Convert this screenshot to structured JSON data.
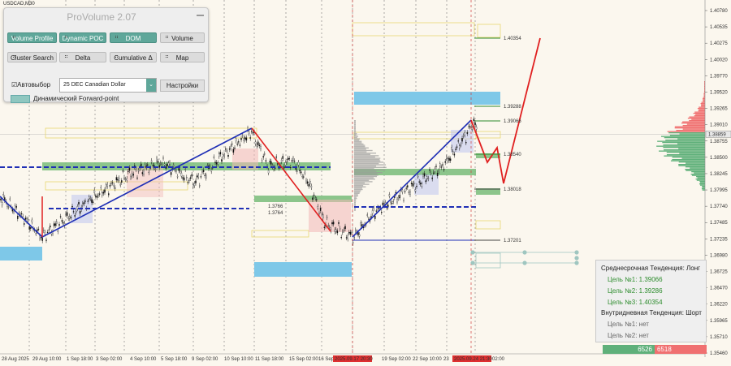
{
  "symbol": "USDCAD,M30",
  "panel": {
    "title": "ProVolume 2.07",
    "buttons": [
      {
        "label": "Volume Profile",
        "active": true
      },
      {
        "label": "Dynamic POC",
        "active": true
      },
      {
        "label": "DOM",
        "active": true
      },
      {
        "label": "Volume",
        "active": false
      },
      {
        "label": "Cluster Search",
        "active": false
      },
      {
        "label": "Delta",
        "active": false
      },
      {
        "label": "Cumulative Δ",
        "active": false
      },
      {
        "label": "Map",
        "active": false
      }
    ],
    "autoselect_label": "Автовыбор",
    "instrument": "25 DEC Canadian Dollar",
    "settings_label": "Настройки",
    "forward_label": "Динамический Forward-point"
  },
  "price_axis": [
    "1.40780",
    "1.40535",
    "1.40275",
    "1.40020",
    "1.39770",
    "1.39520",
    "1.39265",
    "1.39010",
    "1.38755",
    "1.38500",
    "1.38245",
    "1.37995",
    "1.37740",
    "1.37485",
    "1.37235",
    "1.36980",
    "1.36725",
    "1.36470",
    "1.36220",
    "1.35965",
    "1.35710",
    "1.35460"
  ],
  "current_price": "1.38859",
  "time_axis": [
    "28 Aug 2025",
    "29 Aug 10:00",
    "1 Sep 18:00",
    "3 Sep 02:00",
    "4 Sep 10:00",
    "5 Sep 18:00",
    "9 Sep 02:00",
    "10 Sep 10:00",
    "11 Sep 18:00",
    "15 Sep 02:00",
    "16 Sep",
    "19 Sep 02:00",
    "22 Sep 10:00",
    "23"
  ],
  "time_markers": [
    "2025.09.17 20:30",
    "2025.09.24 21:30"
  ],
  "time_tail": "02:00",
  "levels": [
    {
      "label": "1.40354",
      "color": "#2e8b2e"
    },
    {
      "label": "1.39288",
      "color": "#2e8b2e"
    },
    {
      "label": "1.39066",
      "color": "#2e8b2e"
    },
    {
      "label": "1.38540",
      "color": "#2e8b2e"
    },
    {
      "label": "1.38018",
      "color": "#444444"
    },
    {
      "label": "1.37201",
      "color": "#444444"
    }
  ],
  "boxlabels": [
    "1.3766",
    "1.3764"
  ],
  "trend": {
    "medium_label": "Среднесрочная Тенденция: Лонг",
    "targets_long": [
      {
        "label": "Цель №1:",
        "value": "1.39066"
      },
      {
        "label": "Цель №2:",
        "value": "1.39286"
      },
      {
        "label": "Цель №3:",
        "value": "1.40354"
      }
    ],
    "intraday_label": "Внутридневная Тенденция: Шорт",
    "targets_short": [
      {
        "label": "Цель №1:",
        "value": "нет"
      },
      {
        "label": "Цель №2:",
        "value": "нет"
      }
    ]
  },
  "volume": {
    "buy": "6526",
    "sell": "6518"
  },
  "colors": {
    "bull_line": "#1f2fb5",
    "bear_line": "#e02020",
    "buy": "#5fb07a",
    "sell": "#f07070",
    "zone_blue": "#7ec8e8",
    "zone_green": "#7fbf7f"
  }
}
